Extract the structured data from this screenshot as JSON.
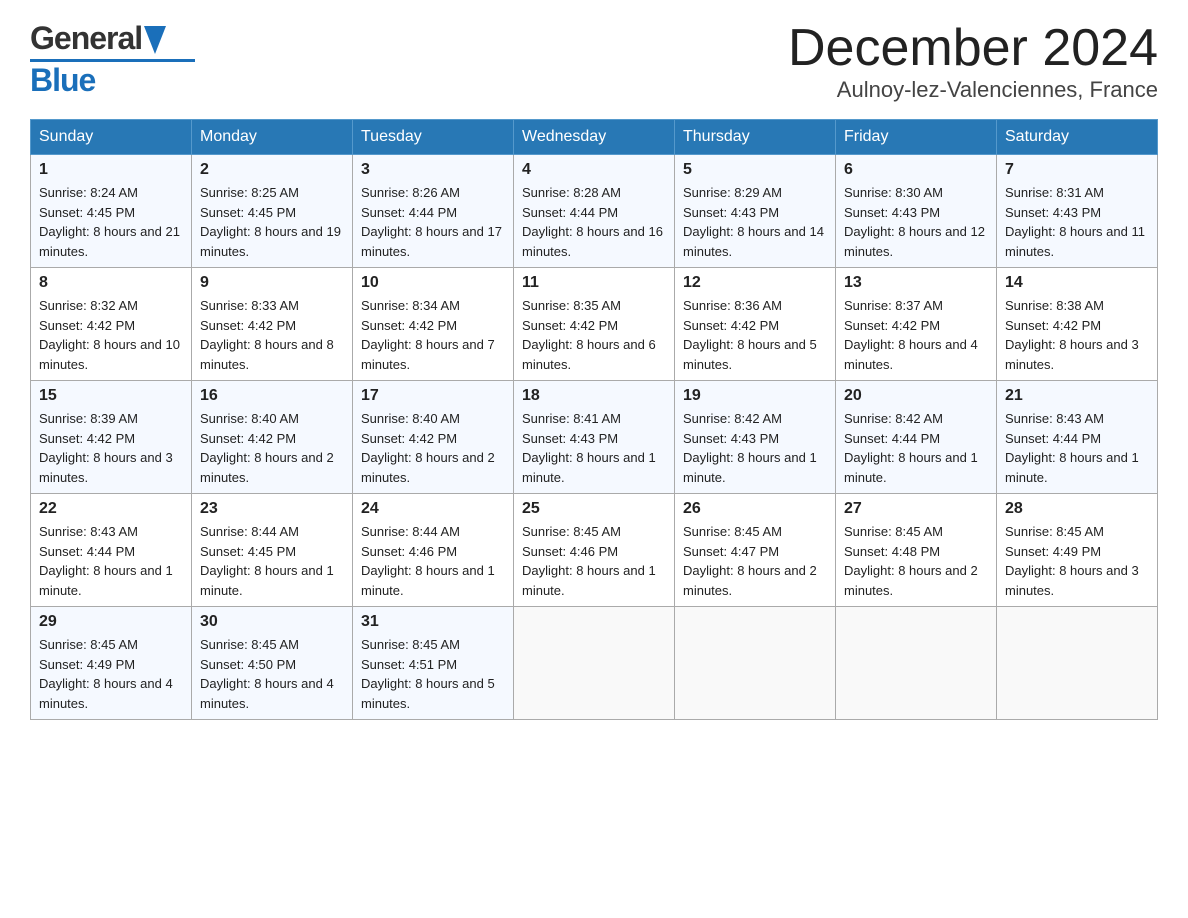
{
  "header": {
    "logo_general": "General",
    "logo_blue": "Blue",
    "month_title": "December 2024",
    "location": "Aulnoy-lez-Valenciennes, France"
  },
  "weekdays": [
    "Sunday",
    "Monday",
    "Tuesday",
    "Wednesday",
    "Thursday",
    "Friday",
    "Saturday"
  ],
  "weeks": [
    [
      {
        "day": "1",
        "sunrise": "8:24 AM",
        "sunset": "4:45 PM",
        "daylight": "8 hours and 21 minutes."
      },
      {
        "day": "2",
        "sunrise": "8:25 AM",
        "sunset": "4:45 PM",
        "daylight": "8 hours and 19 minutes."
      },
      {
        "day": "3",
        "sunrise": "8:26 AM",
        "sunset": "4:44 PM",
        "daylight": "8 hours and 17 minutes."
      },
      {
        "day": "4",
        "sunrise": "8:28 AM",
        "sunset": "4:44 PM",
        "daylight": "8 hours and 16 minutes."
      },
      {
        "day": "5",
        "sunrise": "8:29 AM",
        "sunset": "4:43 PM",
        "daylight": "8 hours and 14 minutes."
      },
      {
        "day": "6",
        "sunrise": "8:30 AM",
        "sunset": "4:43 PM",
        "daylight": "8 hours and 12 minutes."
      },
      {
        "day": "7",
        "sunrise": "8:31 AM",
        "sunset": "4:43 PM",
        "daylight": "8 hours and 11 minutes."
      }
    ],
    [
      {
        "day": "8",
        "sunrise": "8:32 AM",
        "sunset": "4:42 PM",
        "daylight": "8 hours and 10 minutes."
      },
      {
        "day": "9",
        "sunrise": "8:33 AM",
        "sunset": "4:42 PM",
        "daylight": "8 hours and 8 minutes."
      },
      {
        "day": "10",
        "sunrise": "8:34 AM",
        "sunset": "4:42 PM",
        "daylight": "8 hours and 7 minutes."
      },
      {
        "day": "11",
        "sunrise": "8:35 AM",
        "sunset": "4:42 PM",
        "daylight": "8 hours and 6 minutes."
      },
      {
        "day": "12",
        "sunrise": "8:36 AM",
        "sunset": "4:42 PM",
        "daylight": "8 hours and 5 minutes."
      },
      {
        "day": "13",
        "sunrise": "8:37 AM",
        "sunset": "4:42 PM",
        "daylight": "8 hours and 4 minutes."
      },
      {
        "day": "14",
        "sunrise": "8:38 AM",
        "sunset": "4:42 PM",
        "daylight": "8 hours and 3 minutes."
      }
    ],
    [
      {
        "day": "15",
        "sunrise": "8:39 AM",
        "sunset": "4:42 PM",
        "daylight": "8 hours and 3 minutes."
      },
      {
        "day": "16",
        "sunrise": "8:40 AM",
        "sunset": "4:42 PM",
        "daylight": "8 hours and 2 minutes."
      },
      {
        "day": "17",
        "sunrise": "8:40 AM",
        "sunset": "4:42 PM",
        "daylight": "8 hours and 2 minutes."
      },
      {
        "day": "18",
        "sunrise": "8:41 AM",
        "sunset": "4:43 PM",
        "daylight": "8 hours and 1 minute."
      },
      {
        "day": "19",
        "sunrise": "8:42 AM",
        "sunset": "4:43 PM",
        "daylight": "8 hours and 1 minute."
      },
      {
        "day": "20",
        "sunrise": "8:42 AM",
        "sunset": "4:44 PM",
        "daylight": "8 hours and 1 minute."
      },
      {
        "day": "21",
        "sunrise": "8:43 AM",
        "sunset": "4:44 PM",
        "daylight": "8 hours and 1 minute."
      }
    ],
    [
      {
        "day": "22",
        "sunrise": "8:43 AM",
        "sunset": "4:44 PM",
        "daylight": "8 hours and 1 minute."
      },
      {
        "day": "23",
        "sunrise": "8:44 AM",
        "sunset": "4:45 PM",
        "daylight": "8 hours and 1 minute."
      },
      {
        "day": "24",
        "sunrise": "8:44 AM",
        "sunset": "4:46 PM",
        "daylight": "8 hours and 1 minute."
      },
      {
        "day": "25",
        "sunrise": "8:45 AM",
        "sunset": "4:46 PM",
        "daylight": "8 hours and 1 minute."
      },
      {
        "day": "26",
        "sunrise": "8:45 AM",
        "sunset": "4:47 PM",
        "daylight": "8 hours and 2 minutes."
      },
      {
        "day": "27",
        "sunrise": "8:45 AM",
        "sunset": "4:48 PM",
        "daylight": "8 hours and 2 minutes."
      },
      {
        "day": "28",
        "sunrise": "8:45 AM",
        "sunset": "4:49 PM",
        "daylight": "8 hours and 3 minutes."
      }
    ],
    [
      {
        "day": "29",
        "sunrise": "8:45 AM",
        "sunset": "4:49 PM",
        "daylight": "8 hours and 4 minutes."
      },
      {
        "day": "30",
        "sunrise": "8:45 AM",
        "sunset": "4:50 PM",
        "daylight": "8 hours and 4 minutes."
      },
      {
        "day": "31",
        "sunrise": "8:45 AM",
        "sunset": "4:51 PM",
        "daylight": "8 hours and 5 minutes."
      },
      null,
      null,
      null,
      null
    ]
  ]
}
